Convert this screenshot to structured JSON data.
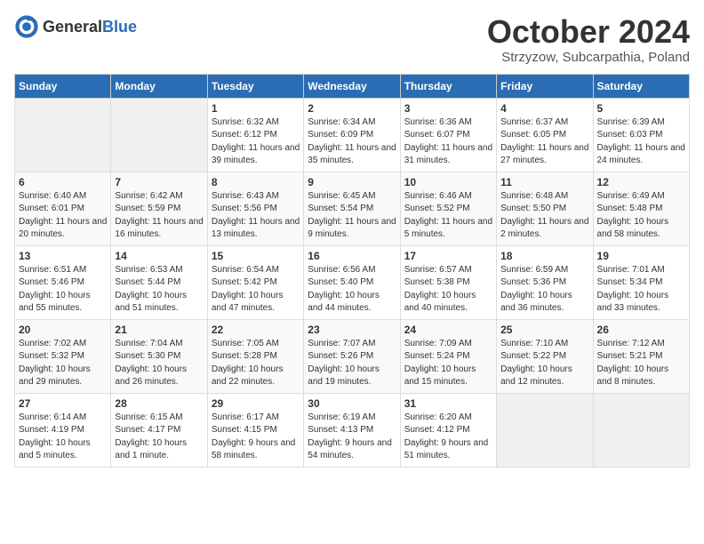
{
  "header": {
    "logo_general": "General",
    "logo_blue": "Blue",
    "month": "October 2024",
    "location": "Strzyzow, Subcarpathia, Poland"
  },
  "days_of_week": [
    "Sunday",
    "Monday",
    "Tuesday",
    "Wednesday",
    "Thursday",
    "Friday",
    "Saturday"
  ],
  "weeks": [
    [
      {
        "day": "",
        "info": ""
      },
      {
        "day": "",
        "info": ""
      },
      {
        "day": "1",
        "info": "Sunrise: 6:32 AM\nSunset: 6:12 PM\nDaylight: 11 hours and 39 minutes."
      },
      {
        "day": "2",
        "info": "Sunrise: 6:34 AM\nSunset: 6:09 PM\nDaylight: 11 hours and 35 minutes."
      },
      {
        "day": "3",
        "info": "Sunrise: 6:36 AM\nSunset: 6:07 PM\nDaylight: 11 hours and 31 minutes."
      },
      {
        "day": "4",
        "info": "Sunrise: 6:37 AM\nSunset: 6:05 PM\nDaylight: 11 hours and 27 minutes."
      },
      {
        "day": "5",
        "info": "Sunrise: 6:39 AM\nSunset: 6:03 PM\nDaylight: 11 hours and 24 minutes."
      }
    ],
    [
      {
        "day": "6",
        "info": "Sunrise: 6:40 AM\nSunset: 6:01 PM\nDaylight: 11 hours and 20 minutes."
      },
      {
        "day": "7",
        "info": "Sunrise: 6:42 AM\nSunset: 5:59 PM\nDaylight: 11 hours and 16 minutes."
      },
      {
        "day": "8",
        "info": "Sunrise: 6:43 AM\nSunset: 5:56 PM\nDaylight: 11 hours and 13 minutes."
      },
      {
        "day": "9",
        "info": "Sunrise: 6:45 AM\nSunset: 5:54 PM\nDaylight: 11 hours and 9 minutes."
      },
      {
        "day": "10",
        "info": "Sunrise: 6:46 AM\nSunset: 5:52 PM\nDaylight: 11 hours and 5 minutes."
      },
      {
        "day": "11",
        "info": "Sunrise: 6:48 AM\nSunset: 5:50 PM\nDaylight: 11 hours and 2 minutes."
      },
      {
        "day": "12",
        "info": "Sunrise: 6:49 AM\nSunset: 5:48 PM\nDaylight: 10 hours and 58 minutes."
      }
    ],
    [
      {
        "day": "13",
        "info": "Sunrise: 6:51 AM\nSunset: 5:46 PM\nDaylight: 10 hours and 55 minutes."
      },
      {
        "day": "14",
        "info": "Sunrise: 6:53 AM\nSunset: 5:44 PM\nDaylight: 10 hours and 51 minutes."
      },
      {
        "day": "15",
        "info": "Sunrise: 6:54 AM\nSunset: 5:42 PM\nDaylight: 10 hours and 47 minutes."
      },
      {
        "day": "16",
        "info": "Sunrise: 6:56 AM\nSunset: 5:40 PM\nDaylight: 10 hours and 44 minutes."
      },
      {
        "day": "17",
        "info": "Sunrise: 6:57 AM\nSunset: 5:38 PM\nDaylight: 10 hours and 40 minutes."
      },
      {
        "day": "18",
        "info": "Sunrise: 6:59 AM\nSunset: 5:36 PM\nDaylight: 10 hours and 36 minutes."
      },
      {
        "day": "19",
        "info": "Sunrise: 7:01 AM\nSunset: 5:34 PM\nDaylight: 10 hours and 33 minutes."
      }
    ],
    [
      {
        "day": "20",
        "info": "Sunrise: 7:02 AM\nSunset: 5:32 PM\nDaylight: 10 hours and 29 minutes."
      },
      {
        "day": "21",
        "info": "Sunrise: 7:04 AM\nSunset: 5:30 PM\nDaylight: 10 hours and 26 minutes."
      },
      {
        "day": "22",
        "info": "Sunrise: 7:05 AM\nSunset: 5:28 PM\nDaylight: 10 hours and 22 minutes."
      },
      {
        "day": "23",
        "info": "Sunrise: 7:07 AM\nSunset: 5:26 PM\nDaylight: 10 hours and 19 minutes."
      },
      {
        "day": "24",
        "info": "Sunrise: 7:09 AM\nSunset: 5:24 PM\nDaylight: 10 hours and 15 minutes."
      },
      {
        "day": "25",
        "info": "Sunrise: 7:10 AM\nSunset: 5:22 PM\nDaylight: 10 hours and 12 minutes."
      },
      {
        "day": "26",
        "info": "Sunrise: 7:12 AM\nSunset: 5:21 PM\nDaylight: 10 hours and 8 minutes."
      }
    ],
    [
      {
        "day": "27",
        "info": "Sunrise: 6:14 AM\nSunset: 4:19 PM\nDaylight: 10 hours and 5 minutes."
      },
      {
        "day": "28",
        "info": "Sunrise: 6:15 AM\nSunset: 4:17 PM\nDaylight: 10 hours and 1 minute."
      },
      {
        "day": "29",
        "info": "Sunrise: 6:17 AM\nSunset: 4:15 PM\nDaylight: 9 hours and 58 minutes."
      },
      {
        "day": "30",
        "info": "Sunrise: 6:19 AM\nSunset: 4:13 PM\nDaylight: 9 hours and 54 minutes."
      },
      {
        "day": "31",
        "info": "Sunrise: 6:20 AM\nSunset: 4:12 PM\nDaylight: 9 hours and 51 minutes."
      },
      {
        "day": "",
        "info": ""
      },
      {
        "day": "",
        "info": ""
      }
    ]
  ]
}
